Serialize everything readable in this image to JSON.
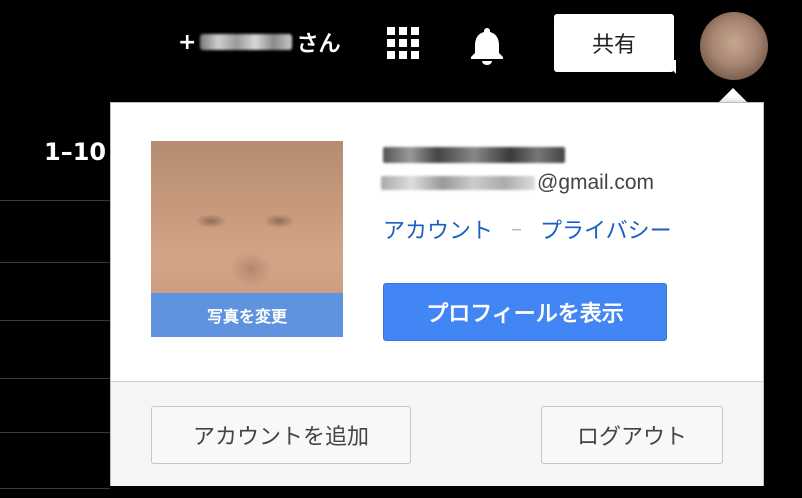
{
  "topbar": {
    "user_prefix": "+",
    "user_suffix": "さん",
    "share_label": "共有"
  },
  "left": {
    "range_text": "1–10"
  },
  "popup": {
    "change_photo_label": "写真を変更",
    "email_domain": "@gmail.com",
    "account_link": "アカウント",
    "separator": "–",
    "privacy_link": "プライバシー",
    "view_profile_label": "プロフィールを表示",
    "add_account_label": "アカウントを追加",
    "logout_label": "ログアウト"
  },
  "icons": {
    "apps": "apps-grid-icon",
    "notifications": "bell-icon"
  },
  "colors": {
    "primary_button": "#4285f4",
    "link": "#1a5ec7",
    "change_photo_overlay": "#5392eb"
  }
}
